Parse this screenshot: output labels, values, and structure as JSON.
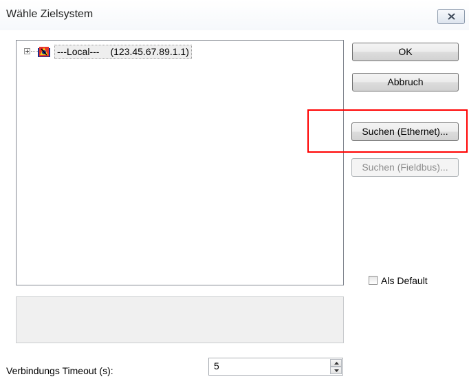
{
  "window": {
    "title": "Wähle Zielsystem"
  },
  "tree": {
    "items": [
      {
        "name": "---Local---",
        "address": "(123.45.67.89.1.1)",
        "icon": "target-system-icon"
      }
    ]
  },
  "buttons": {
    "ok": "OK",
    "abort": "Abbruch",
    "search_ethernet": "Suchen (Ethernet)...",
    "search_fieldbus": "Suchen (Fieldbus)..."
  },
  "default_checkbox": {
    "label": "Als Default",
    "checked": false
  },
  "timeout": {
    "label": "Verbindungs Timeout (s):",
    "value": "5"
  },
  "colors": {
    "highlight": "#ff0000"
  }
}
